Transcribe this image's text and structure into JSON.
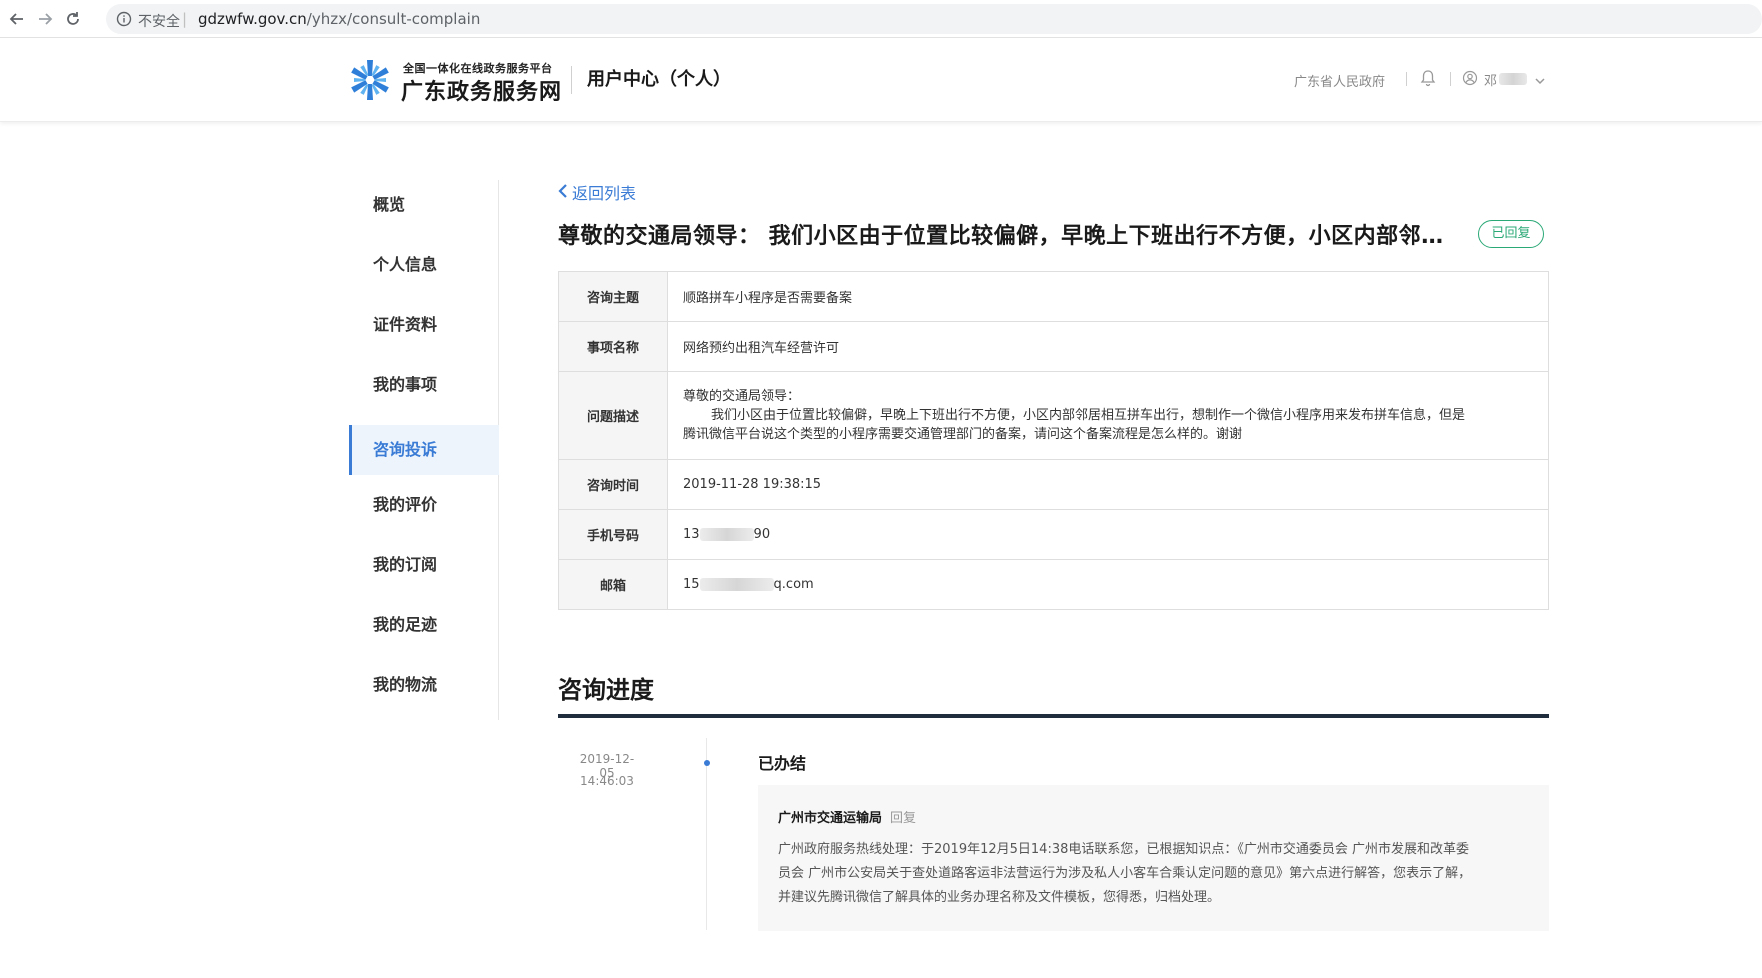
{
  "browser": {
    "insecure_label": "不安全",
    "url_host": "gdzwfw.gov.cn",
    "url_path": "/yhzx/consult-complain"
  },
  "header": {
    "logo_subtitle": "全国一体化在线政务服务平台",
    "logo_title": "广东政务服务网",
    "section_title": "用户中心（个人）",
    "gov_link": "广东省人民政府",
    "user_name": "邓"
  },
  "sidebar": {
    "items": [
      {
        "label": "概览"
      },
      {
        "label": "个人信息"
      },
      {
        "label": "证件资料"
      },
      {
        "label": "我的事项"
      },
      {
        "label": "咨询投诉",
        "active": true
      },
      {
        "label": "我的评价"
      },
      {
        "label": "我的订阅"
      },
      {
        "label": "我的足迹"
      },
      {
        "label": "我的物流"
      }
    ]
  },
  "main": {
    "back_label": "返回列表",
    "title": "尊敬的交通局领导： 我们小区由于位置比较偏僻，早晚上下班出行不方便，小区内部邻居相互拼车出行，想制作一个微信小程序用来发布拼车信息",
    "status_badge": "已回复",
    "details": {
      "subject_label": "咨询主题",
      "subject_value": "顺路拼车小程序是否需要备案",
      "item_label": "事项名称",
      "item_value": "网络预约出租汽车经营许可",
      "desc_label": "问题描述",
      "desc_line1": "尊敬的交通局领导：",
      "desc_line2": "我们小区由于位置比较偏僻，早晚上下班出行不方便，小区内部邻居相互拼车出行，想制作一个微信小程序用来发布拼车信息，但是",
      "desc_line3": "腾讯微信平台说这个类型的小程序需要交通管理部门的备案，请问这个备案流程是怎么样的。谢谢",
      "time_label": "咨询时间",
      "time_value": "2019-11-28 19:38:15",
      "phone_label": "手机号码",
      "phone_prefix": "13",
      "phone_suffix": "90",
      "email_label": "邮箱",
      "email_prefix": "15",
      "email_suffix": "q.com"
    },
    "progress_title": "咨询进度",
    "timeline": {
      "date": "2019-12-05",
      "time": "14:46:03",
      "status": "已办结",
      "reply_org": "广州市交通运输局",
      "reply_tag": "回复",
      "reply_line1": "广州政府服务热线处理：于2019年12月5日14:38电话联系您，已根据知识点：《广州市交通委员会 广州市发展和改革委",
      "reply_line2": "员会 广州市公安局关于查处道路客运非法营运行为涉及私人小客车合乘认定问题的意见》第六点进行解答，您表示了解，",
      "reply_line3": "并建议先腾讯微信了解具体的业务办理名称及文件模板，您得悉，归档处理。"
    }
  },
  "colors": {
    "accent": "#3a7bd5",
    "badge_green": "#2aa876",
    "rule_dark": "#1f2d3d"
  }
}
